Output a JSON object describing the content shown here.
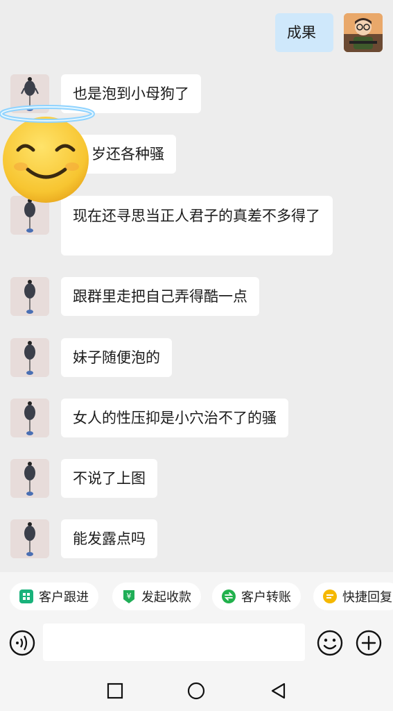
{
  "messages": [
    {
      "dir": "out",
      "text": "成果"
    },
    {
      "dir": "in",
      "text": "也是泡到小母狗了"
    },
    {
      "dir": "in",
      "text": "岁还各种骚"
    },
    {
      "dir": "in",
      "text": "现在还寻思当正人君子的真差不多得了"
    },
    {
      "dir": "in",
      "text": "跟群里走把自己弄得酷一点"
    },
    {
      "dir": "in",
      "text": "妹子随便泡的"
    },
    {
      "dir": "in",
      "text": "女人的性压抑是小穴治不了的骚"
    },
    {
      "dir": "in",
      "text": "不说了上图"
    },
    {
      "dir": "in",
      "text": "能发露点吗"
    }
  ],
  "quick_actions": [
    {
      "label": "客户跟进",
      "icon": "customer-followup-icon",
      "color": "#19b27b"
    },
    {
      "label": "发起收款",
      "icon": "collect-payment-icon",
      "color": "#1fae57"
    },
    {
      "label": "客户转账",
      "icon": "transfer-icon",
      "color": "#21b14c"
    },
    {
      "label": "快捷回复",
      "icon": "quick-reply-icon",
      "color": "#f5b800"
    }
  ],
  "input": {
    "placeholder": ""
  },
  "colors": {
    "background": "#ededed",
    "incoming_bubble": "#ffffff",
    "outgoing_bubble": "#cfe8fb",
    "emoji_overlay": "#f7c531"
  },
  "overlay": {
    "icon": "smiling-face-with-halo-icon"
  },
  "navbar": [
    "square-nav-icon",
    "circle-nav-icon",
    "back-triangle-icon"
  ]
}
